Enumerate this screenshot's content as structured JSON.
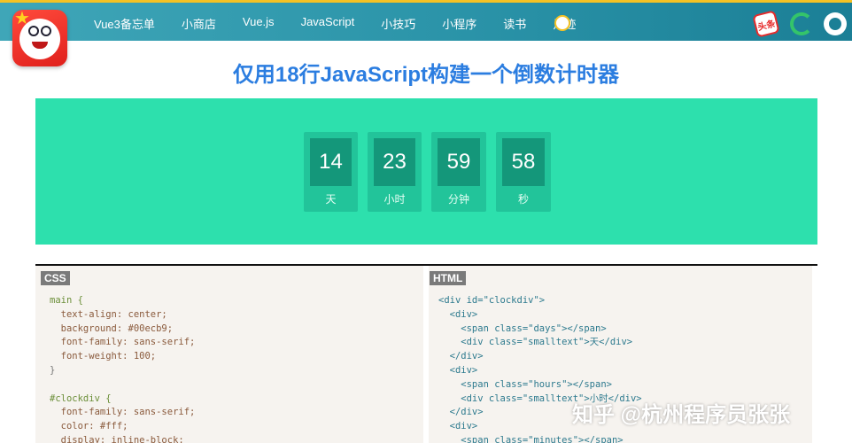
{
  "nav": {
    "items": [
      "Vue3备忘单",
      "小商店",
      "Vue.js",
      "JavaScript",
      "小技巧",
      "小程序",
      "读书",
      "足迹"
    ],
    "toutiao_label": "头条"
  },
  "article": {
    "title": "仅用18行JavaScript构建一个倒数计时器"
  },
  "countdown": {
    "days": "14",
    "days_label": "天",
    "hours": "23",
    "hours_label": "小时",
    "minutes": "59",
    "minutes_label": "分钟",
    "seconds": "58",
    "seconds_label": "秒",
    "background": "#00ecb9"
  },
  "panes": {
    "css_tag": "CSS",
    "html_tag": "HTML",
    "css_lines": [
      "main {",
      "  text-align: center;",
      "  background: #00ecb9;",
      "  font-family: sans-serif;",
      "  font-weight: 100;",
      "}",
      "",
      "#clockdiv {",
      "  font-family: sans-serif;",
      "  color: #fff;",
      "  display: inline-block;"
    ],
    "html_lines": [
      "<div id=\"clockdiv\">",
      "  <div>",
      "    <span class=\"days\"></span>",
      "    <div class=\"smalltext\">天</div>",
      "  </div>",
      "  <div>",
      "    <span class=\"hours\"></span>",
      "    <div class=\"smalltext\">小时</div>",
      "  </div>",
      "  <div>",
      "    <span class=\"minutes\"></span>"
    ]
  },
  "watermark": "知乎 @杭州程序员张张",
  "colors": {
    "title": "#2b7de0",
    "accent_bar": "#f4c224",
    "countdown_bg": "#2de0ad"
  }
}
